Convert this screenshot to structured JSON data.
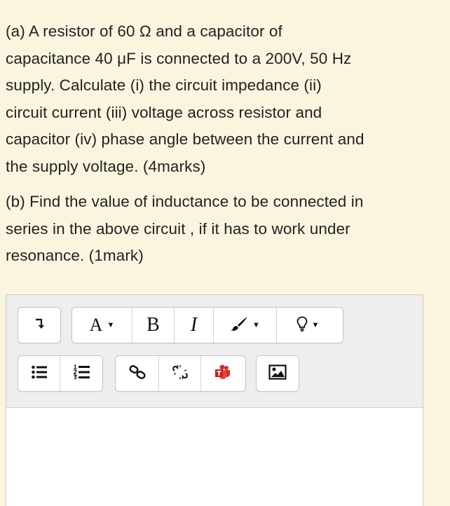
{
  "question": {
    "part_a_lines": [
      "(a) A resistor of 60 Ω and a capacitor of",
      "capacitance 40 μF is connected to a 200V, 50 Hz",
      "supply. Calculate (i) the circuit impedance (ii)",
      "circuit current (iii) voltage across resistor and",
      "capacitor (iv) phase angle between the current and",
      "the supply voltage. (4marks)"
    ],
    "part_b_lines": [
      "(b) Find the value of inductance to be connected in",
      "series in the above circuit , if it has to work under",
      "resonance. (1mark)"
    ]
  },
  "toolbar": {
    "font_style_label": "A",
    "bold_label": "B",
    "italic_label": "I",
    "icons": {
      "collapse": "collapse-arrow-icon",
      "font": "font-color-icon",
      "paint": "paint-brush-icon",
      "lightbulb": "lightbulb-icon",
      "bullet_list": "unordered-list-icon",
      "numbered_list": "ordered-list-icon",
      "link": "link-icon",
      "unlink": "unlink-icon",
      "teams": "teams-icon",
      "image": "image-icon"
    }
  },
  "colors": {
    "page_background": "#fbf5df",
    "toolbar_background": "#eeeeee",
    "teams_red": "#d92b2b"
  }
}
